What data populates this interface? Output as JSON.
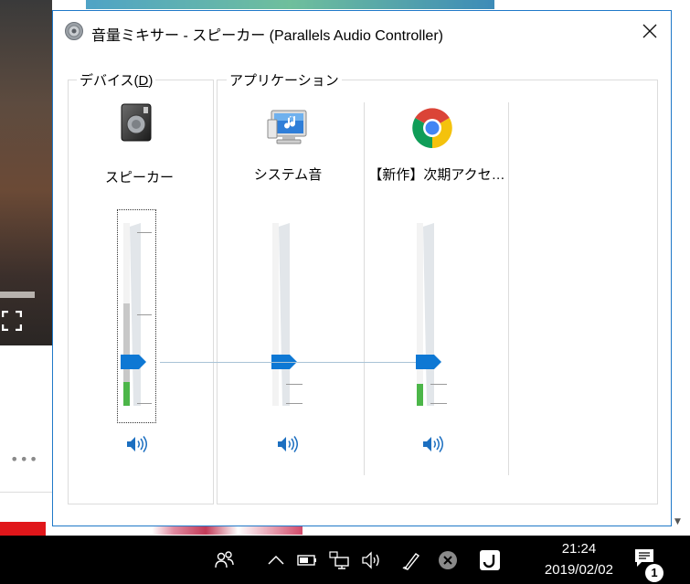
{
  "window": {
    "title": "音量ミキサー - スピーカー (Parallels Audio Controller)",
    "close_symbol": "✕"
  },
  "device_group": {
    "label_prefix": "デバイス(",
    "label_accel": "D",
    "label_suffix": ")",
    "channel": {
      "name": "スピーカー",
      "icon": "speaker-device-icon",
      "volume_pct": 24,
      "meter_grey_pct": 56,
      "meter_green_pct": 13,
      "muted": false
    }
  },
  "apps_group": {
    "label": "アプリケーション",
    "channels": [
      {
        "name": "システム音",
        "icon": "system-sounds-icon",
        "volume_pct": 24,
        "meter_green_pct": 0,
        "muted": false
      },
      {
        "name": "【新作】次期アクセ…",
        "icon": "chrome-icon",
        "volume_pct": 24,
        "meter_green_pct": 12,
        "muted": false
      }
    ]
  },
  "background": {
    "dots": "•••"
  },
  "taskbar": {
    "time": "21:24",
    "date": "2019/02/02",
    "notification_count": "1",
    "tray_icons": [
      "people-icon",
      "chevron-up-icon",
      "battery-icon",
      "network-icon",
      "volume-icon",
      "pen-icon",
      "close-circle-icon",
      "app-icon",
      "notification-icon"
    ]
  },
  "colors": {
    "accent": "#1f79c8",
    "thumb": "#0e78d4",
    "meter_green": "#4cb649",
    "taskbar": "#000000"
  }
}
